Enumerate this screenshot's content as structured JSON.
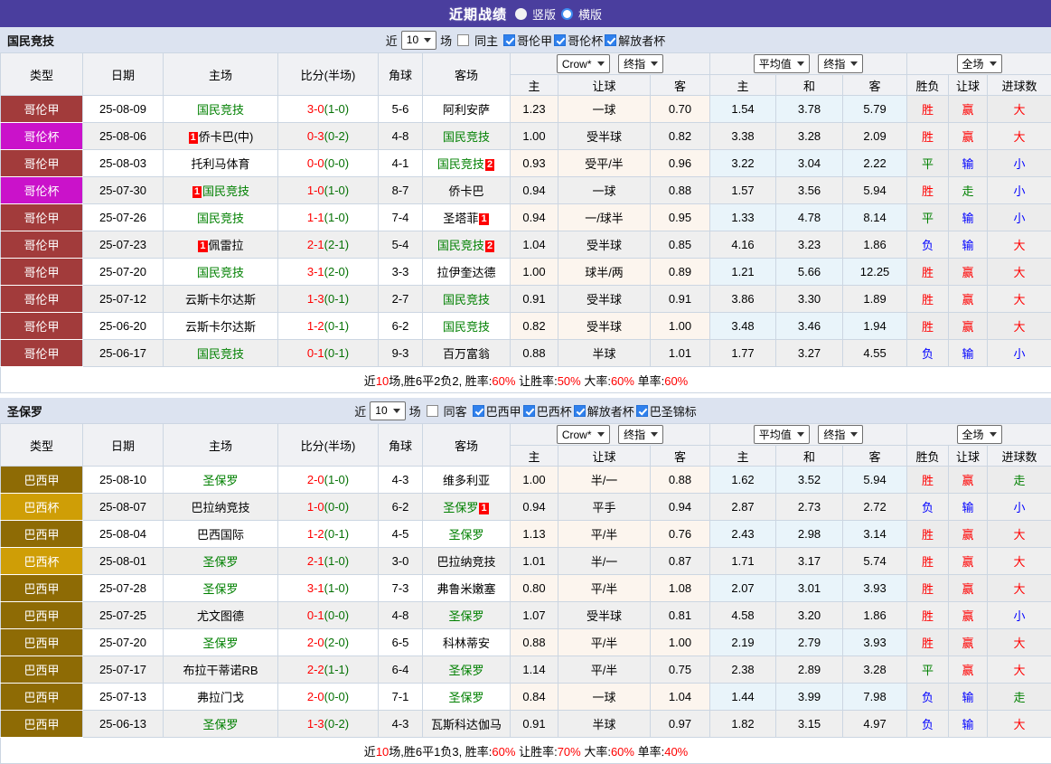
{
  "topbar": {
    "title": "近期战绩",
    "radios": [
      {
        "label": "竖版",
        "selected": true
      },
      {
        "label": "横版",
        "selected": false
      }
    ]
  },
  "colors": {
    "topbar_bg": "#4a3e9e",
    "section_bar_bg": "#dce3f0",
    "league_colors": {
      "哥伦甲": "#a23b3b",
      "哥伦杯": "#ca12ca",
      "巴西甲": "#8e6b05",
      "巴西杯": "#cf9e06"
    },
    "result_colors": {
      "胜": "#ff0000",
      "赢": "#ff0000",
      "大": "#ff0000",
      "平": "#008000",
      "走": "#008000",
      "负": "#0000ff",
      "输": "#0000ff",
      "小": "#0000ff"
    },
    "subject_team_color": "#008000",
    "score_color": "#ff0000",
    "half_score_color": "#057105"
  },
  "sections": [
    {
      "team": "国民竞技",
      "controls": {
        "near_label": "近",
        "select_value": "10",
        "games_label": "场",
        "same_label": "同主",
        "same_checked": false,
        "leagues": [
          {
            "label": "哥伦甲",
            "checked": true
          },
          {
            "label": "哥伦杯",
            "checked": true
          },
          {
            "label": "解放者杯",
            "checked": true
          }
        ]
      },
      "header": {
        "cols": [
          "类型",
          "日期",
          "主场",
          "比分(半场)",
          "角球",
          "客场"
        ],
        "odds_group": {
          "select1": "Crow*",
          "select2": "终指",
          "subs": [
            "主",
            "让球",
            "客"
          ]
        },
        "avg_group": {
          "select1": "平均值",
          "select2": "终指",
          "subs": [
            "主",
            "和",
            "客"
          ]
        },
        "result_group": {
          "select": "全场",
          "subs": [
            "胜负",
            "让球",
            "进球数"
          ]
        }
      },
      "rows": [
        {
          "type": "哥伦甲",
          "date": "25-08-09",
          "home": {
            "name": "国民竞技",
            "green": true
          },
          "score": "3-0",
          "half": "(1-0)",
          "corner": "5-6",
          "away": {
            "name": "阿利安萨",
            "green": false
          },
          "odds": [
            "1.23",
            "一球",
            "0.70"
          ],
          "avg": [
            "1.54",
            "3.78",
            "5.79"
          ],
          "results": [
            "胜",
            "赢",
            "大"
          ]
        },
        {
          "type": "哥伦杯",
          "date": "25-08-06",
          "home": {
            "name": "侨卡巴(中)",
            "green": false,
            "badge_before": "1"
          },
          "score": "0-3",
          "half": "(0-2)",
          "corner": "4-8",
          "away": {
            "name": "国民竞技",
            "green": true
          },
          "odds": [
            "1.00",
            "受半球",
            "0.82"
          ],
          "avg": [
            "3.38",
            "3.28",
            "2.09"
          ],
          "results": [
            "胜",
            "赢",
            "大"
          ]
        },
        {
          "type": "哥伦甲",
          "date": "25-08-03",
          "home": {
            "name": "托利马体育",
            "green": false
          },
          "score": "0-0",
          "half": "(0-0)",
          "corner": "4-1",
          "away": {
            "name": "国民竞技",
            "green": true,
            "badge_after": "2"
          },
          "odds": [
            "0.93",
            "受平/半",
            "0.96"
          ],
          "avg": [
            "3.22",
            "3.04",
            "2.22"
          ],
          "results": [
            "平",
            "输",
            "小"
          ]
        },
        {
          "type": "哥伦杯",
          "date": "25-07-30",
          "home": {
            "name": "国民竞技",
            "green": true,
            "badge_before": "1"
          },
          "score": "1-0",
          "half": "(1-0)",
          "corner": "8-7",
          "away": {
            "name": "侨卡巴",
            "green": false
          },
          "odds": [
            "0.94",
            "一球",
            "0.88"
          ],
          "avg": [
            "1.57",
            "3.56",
            "5.94"
          ],
          "results": [
            "胜",
            "走",
            "小"
          ]
        },
        {
          "type": "哥伦甲",
          "date": "25-07-26",
          "home": {
            "name": "国民竞技",
            "green": true
          },
          "score": "1-1",
          "half": "(1-0)",
          "corner": "7-4",
          "away": {
            "name": "圣塔菲",
            "green": false,
            "badge_after": "1"
          },
          "odds": [
            "0.94",
            "一/球半",
            "0.95"
          ],
          "avg": [
            "1.33",
            "4.78",
            "8.14"
          ],
          "results": [
            "平",
            "输",
            "小"
          ]
        },
        {
          "type": "哥伦甲",
          "date": "25-07-23",
          "home": {
            "name": "佩雷拉",
            "green": false,
            "badge_before": "1"
          },
          "score": "2-1",
          "half": "(2-1)",
          "corner": "5-4",
          "away": {
            "name": "国民竞技",
            "green": true,
            "badge_after": "2"
          },
          "odds": [
            "1.04",
            "受半球",
            "0.85"
          ],
          "avg": [
            "4.16",
            "3.23",
            "1.86"
          ],
          "results": [
            "负",
            "输",
            "大"
          ]
        },
        {
          "type": "哥伦甲",
          "date": "25-07-20",
          "home": {
            "name": "国民竞技",
            "green": true
          },
          "score": "3-1",
          "half": "(2-0)",
          "corner": "3-3",
          "away": {
            "name": "拉伊奎达德",
            "green": false
          },
          "odds": [
            "1.00",
            "球半/两",
            "0.89"
          ],
          "avg": [
            "1.21",
            "5.66",
            "12.25"
          ],
          "results": [
            "胜",
            "赢",
            "大"
          ]
        },
        {
          "type": "哥伦甲",
          "date": "25-07-12",
          "home": {
            "name": "云斯卡尔达斯",
            "green": false
          },
          "score": "1-3",
          "half": "(0-1)",
          "corner": "2-7",
          "away": {
            "name": "国民竞技",
            "green": true
          },
          "odds": [
            "0.91",
            "受半球",
            "0.91"
          ],
          "avg": [
            "3.86",
            "3.30",
            "1.89"
          ],
          "results": [
            "胜",
            "赢",
            "大"
          ]
        },
        {
          "type": "哥伦甲",
          "date": "25-06-20",
          "home": {
            "name": "云斯卡尔达斯",
            "green": false
          },
          "score": "1-2",
          "half": "(0-1)",
          "corner": "6-2",
          "away": {
            "name": "国民竞技",
            "green": true
          },
          "odds": [
            "0.82",
            "受半球",
            "1.00"
          ],
          "avg": [
            "3.48",
            "3.46",
            "1.94"
          ],
          "results": [
            "胜",
            "赢",
            "大"
          ]
        },
        {
          "type": "哥伦甲",
          "date": "25-06-17",
          "home": {
            "name": "国民竞技",
            "green": true
          },
          "score": "0-1",
          "half": "(0-1)",
          "corner": "9-3",
          "away": {
            "name": "百万富翁",
            "green": false
          },
          "odds": [
            "0.88",
            "半球",
            "1.01"
          ],
          "avg": [
            "1.77",
            "3.27",
            "4.55"
          ],
          "results": [
            "负",
            "输",
            "小"
          ]
        }
      ],
      "summary": [
        {
          "t": "近"
        },
        {
          "t": "10",
          "red": true
        },
        {
          "t": "场,胜6平2负2, 胜率:"
        },
        {
          "t": "60%",
          "red": true
        },
        {
          "t": " 让胜率:"
        },
        {
          "t": "50%",
          "red": true
        },
        {
          "t": " 大率:"
        },
        {
          "t": "60%",
          "red": true
        },
        {
          "t": " 单率:"
        },
        {
          "t": "60%",
          "red": true
        }
      ]
    },
    {
      "team": "圣保罗",
      "controls": {
        "near_label": "近",
        "select_value": "10",
        "games_label": "场",
        "same_label": "同客",
        "same_checked": false,
        "leagues": [
          {
            "label": "巴西甲",
            "checked": true
          },
          {
            "label": "巴西杯",
            "checked": true
          },
          {
            "label": "解放者杯",
            "checked": true
          },
          {
            "label": "巴圣锦标",
            "checked": true
          }
        ]
      },
      "header": {
        "cols": [
          "类型",
          "日期",
          "主场",
          "比分(半场)",
          "角球",
          "客场"
        ],
        "odds_group": {
          "select1": "Crow*",
          "select2": "终指",
          "subs": [
            "主",
            "让球",
            "客"
          ]
        },
        "avg_group": {
          "select1": "平均值",
          "select2": "终指",
          "subs": [
            "主",
            "和",
            "客"
          ]
        },
        "result_group": {
          "select": "全场",
          "subs": [
            "胜负",
            "让球",
            "进球数"
          ]
        }
      },
      "rows": [
        {
          "type": "巴西甲",
          "date": "25-08-10",
          "home": {
            "name": "圣保罗",
            "green": true
          },
          "score": "2-0",
          "half": "(1-0)",
          "corner": "4-3",
          "away": {
            "name": "维多利亚",
            "green": false
          },
          "odds": [
            "1.00",
            "半/一",
            "0.88"
          ],
          "avg": [
            "1.62",
            "3.52",
            "5.94"
          ],
          "results": [
            "胜",
            "赢",
            "走"
          ]
        },
        {
          "type": "巴西杯",
          "date": "25-08-07",
          "home": {
            "name": "巴拉纳竞技",
            "green": false
          },
          "score": "1-0",
          "half": "(0-0)",
          "corner": "6-2",
          "away": {
            "name": "圣保罗",
            "green": true,
            "badge_after": "1"
          },
          "odds": [
            "0.94",
            "平手",
            "0.94"
          ],
          "avg": [
            "2.87",
            "2.73",
            "2.72"
          ],
          "results": [
            "负",
            "输",
            "小"
          ]
        },
        {
          "type": "巴西甲",
          "date": "25-08-04",
          "home": {
            "name": "巴西国际",
            "green": false
          },
          "score": "1-2",
          "half": "(0-1)",
          "corner": "4-5",
          "away": {
            "name": "圣保罗",
            "green": true
          },
          "odds": [
            "1.13",
            "平/半",
            "0.76"
          ],
          "avg": [
            "2.43",
            "2.98",
            "3.14"
          ],
          "results": [
            "胜",
            "赢",
            "大"
          ]
        },
        {
          "type": "巴西杯",
          "date": "25-08-01",
          "home": {
            "name": "圣保罗",
            "green": true
          },
          "score": "2-1",
          "half": "(1-0)",
          "corner": "3-0",
          "away": {
            "name": "巴拉纳竞技",
            "green": false
          },
          "odds": [
            "1.01",
            "半/一",
            "0.87"
          ],
          "avg": [
            "1.71",
            "3.17",
            "5.74"
          ],
          "results": [
            "胜",
            "赢",
            "大"
          ]
        },
        {
          "type": "巴西甲",
          "date": "25-07-28",
          "home": {
            "name": "圣保罗",
            "green": true
          },
          "score": "3-1",
          "half": "(1-0)",
          "corner": "7-3",
          "away": {
            "name": "弗鲁米嫩塞",
            "green": false
          },
          "odds": [
            "0.80",
            "平/半",
            "1.08"
          ],
          "avg": [
            "2.07",
            "3.01",
            "3.93"
          ],
          "results": [
            "胜",
            "赢",
            "大"
          ]
        },
        {
          "type": "巴西甲",
          "date": "25-07-25",
          "home": {
            "name": "尤文图德",
            "green": false
          },
          "score": "0-1",
          "half": "(0-0)",
          "corner": "4-8",
          "away": {
            "name": "圣保罗",
            "green": true
          },
          "odds": [
            "1.07",
            "受半球",
            "0.81"
          ],
          "avg": [
            "4.58",
            "3.20",
            "1.86"
          ],
          "results": [
            "胜",
            "赢",
            "小"
          ]
        },
        {
          "type": "巴西甲",
          "date": "25-07-20",
          "home": {
            "name": "圣保罗",
            "green": true
          },
          "score": "2-0",
          "half": "(2-0)",
          "corner": "6-5",
          "away": {
            "name": "科林蒂安",
            "green": false
          },
          "odds": [
            "0.88",
            "平/半",
            "1.00"
          ],
          "avg": [
            "2.19",
            "2.79",
            "3.93"
          ],
          "results": [
            "胜",
            "赢",
            "大"
          ]
        },
        {
          "type": "巴西甲",
          "date": "25-07-17",
          "home": {
            "name": "布拉干蒂诺RB",
            "green": false
          },
          "score": "2-2",
          "half": "(1-1)",
          "corner": "6-4",
          "away": {
            "name": "圣保罗",
            "green": true
          },
          "odds": [
            "1.14",
            "平/半",
            "0.75"
          ],
          "avg": [
            "2.38",
            "2.89",
            "3.28"
          ],
          "results": [
            "平",
            "赢",
            "大"
          ]
        },
        {
          "type": "巴西甲",
          "date": "25-07-13",
          "home": {
            "name": "弗拉门戈",
            "green": false
          },
          "score": "2-0",
          "half": "(0-0)",
          "corner": "7-1",
          "away": {
            "name": "圣保罗",
            "green": true
          },
          "odds": [
            "0.84",
            "一球",
            "1.04"
          ],
          "avg": [
            "1.44",
            "3.99",
            "7.98"
          ],
          "results": [
            "负",
            "输",
            "走"
          ]
        },
        {
          "type": "巴西甲",
          "date": "25-06-13",
          "home": {
            "name": "圣保罗",
            "green": true
          },
          "score": "1-3",
          "half": "(0-2)",
          "corner": "4-3",
          "away": {
            "name": "瓦斯科达伽马",
            "green": false
          },
          "odds": [
            "0.91",
            "半球",
            "0.97"
          ],
          "avg": [
            "1.82",
            "3.15",
            "4.97"
          ],
          "results": [
            "负",
            "输",
            "大"
          ]
        }
      ],
      "summary": [
        {
          "t": "近"
        },
        {
          "t": "10",
          "red": true
        },
        {
          "t": "场,胜6平1负3, 胜率:"
        },
        {
          "t": "60%",
          "red": true
        },
        {
          "t": " 让胜率:"
        },
        {
          "t": "70%",
          "red": true
        },
        {
          "t": " 大率:"
        },
        {
          "t": "60%",
          "red": true
        },
        {
          "t": " 单率:"
        },
        {
          "t": "40%",
          "red": true
        }
      ]
    }
  ]
}
